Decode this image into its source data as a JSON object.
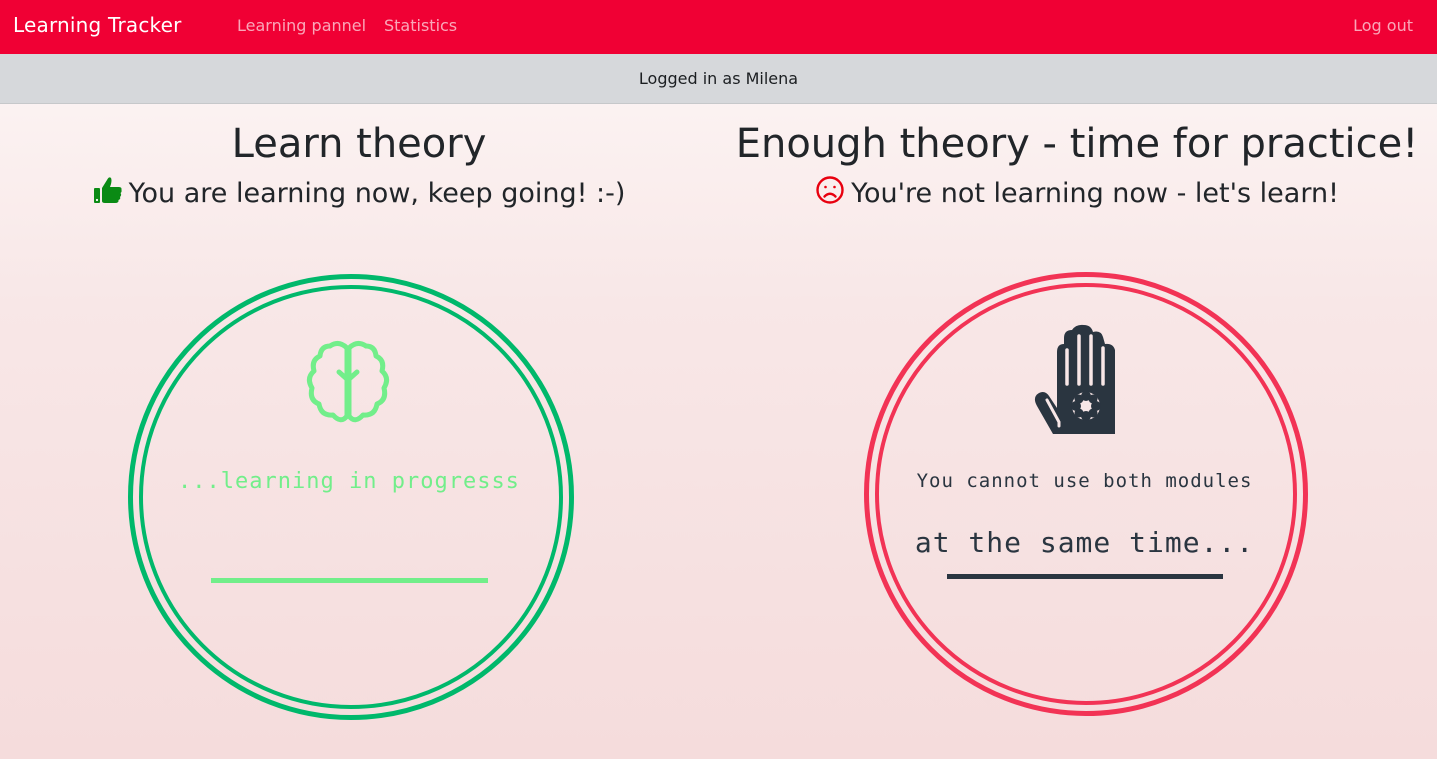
{
  "navbar": {
    "brand": "Learning Tracker",
    "links": [
      "Learning pannel",
      "Statistics"
    ],
    "logout": "Log out",
    "background": "#f00034"
  },
  "session": {
    "logged_in_text": "Logged in as Milena"
  },
  "theory": {
    "title": "Learn theory",
    "status": "You are learning now, keep going! :-)",
    "status_icon": "thumbs-up-icon",
    "module_icon": "brain-icon",
    "module_text": "...learning in progresss",
    "accent": "#00b86b",
    "text_color": "#72ee8a"
  },
  "practice": {
    "title": "Enough theory - time for practice!",
    "status": "You're not learning now - let's learn!",
    "status_icon": "sad-face-icon",
    "module_icon": "stop-hand-icon",
    "module_text_line1": "You cannot use both modules",
    "module_text_line2": "at the same time...",
    "accent": "#f23355",
    "text_color": "#2a3540"
  }
}
